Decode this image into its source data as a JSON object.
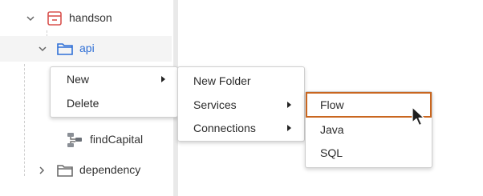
{
  "tree": {
    "items": [
      {
        "label": "handson",
        "icon": "database-icon",
        "expanded": true
      },
      {
        "label": "api",
        "icon": "folder-open-icon",
        "expanded": true
      },
      {
        "label": "findCapital",
        "icon": "flow-service-icon"
      },
      {
        "label": "dependency",
        "icon": "folder-icon",
        "expanded": false
      }
    ]
  },
  "context_menu": {
    "items": [
      {
        "label": "New",
        "submenu": true
      },
      {
        "label": "Delete",
        "submenu": false
      }
    ]
  },
  "new_submenu": {
    "items": [
      {
        "label": "New Folder",
        "submenu": false
      },
      {
        "label": "Services",
        "submenu": true
      },
      {
        "label": "Connections",
        "submenu": true
      }
    ]
  },
  "services_submenu": {
    "items": [
      {
        "label": "Flow",
        "selected": true
      },
      {
        "label": "Java"
      },
      {
        "label": "SQL"
      }
    ]
  },
  "colors": {
    "selection_border": "#c9661f",
    "icon_red": "#d9534f",
    "icon_blue": "#2f6fd6"
  }
}
